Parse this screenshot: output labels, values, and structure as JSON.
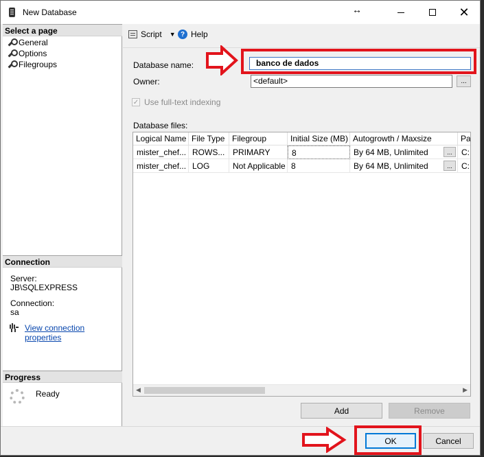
{
  "window": {
    "title": "New Database",
    "resize_glyph": "↔",
    "close_glyph": "✕"
  },
  "left_pane": {
    "select_page_header": "Select a page",
    "pages": [
      "General",
      "Options",
      "Filegroups"
    ],
    "connection_header": "Connection",
    "server_label": "Server:",
    "server_value": "JB\\SQLEXPRESS",
    "connection_label": "Connection:",
    "connection_value": "sa",
    "view_props_link": "View connection properties",
    "progress_header": "Progress",
    "progress_status": "Ready"
  },
  "toolbar": {
    "script_label": "Script",
    "help_label": "Help",
    "help_glyph": "?",
    "caret_glyph": "▼"
  },
  "form": {
    "db_name_label": "Database name:",
    "db_name_value": "banco de dados",
    "owner_label": "Owner:",
    "owner_value": "<default>",
    "ellipsis": "...",
    "fulltext_label": "Use full-text indexing",
    "fulltext_checked": true,
    "check_glyph": "✓",
    "db_files_label": "Database files:"
  },
  "grid": {
    "columns": [
      "Logical Name",
      "File Type",
      "Filegroup",
      "Initial Size (MB)",
      "Autogrowth / Maxsize",
      "Pa"
    ],
    "rows": [
      [
        "mister_chef...",
        "ROWS...",
        "PRIMARY",
        "8",
        "By 64 MB, Unlimited",
        "C:"
      ],
      [
        "mister_chef...",
        "LOG",
        "Not Applicable",
        "8",
        "By 64 MB, Unlimited",
        "C:"
      ]
    ],
    "scroll_left": "◀",
    "scroll_right": "▶"
  },
  "buttons": {
    "add": "Add",
    "remove": "Remove",
    "ok": "OK",
    "cancel": "Cancel"
  },
  "annotation_color": "#e2141c"
}
